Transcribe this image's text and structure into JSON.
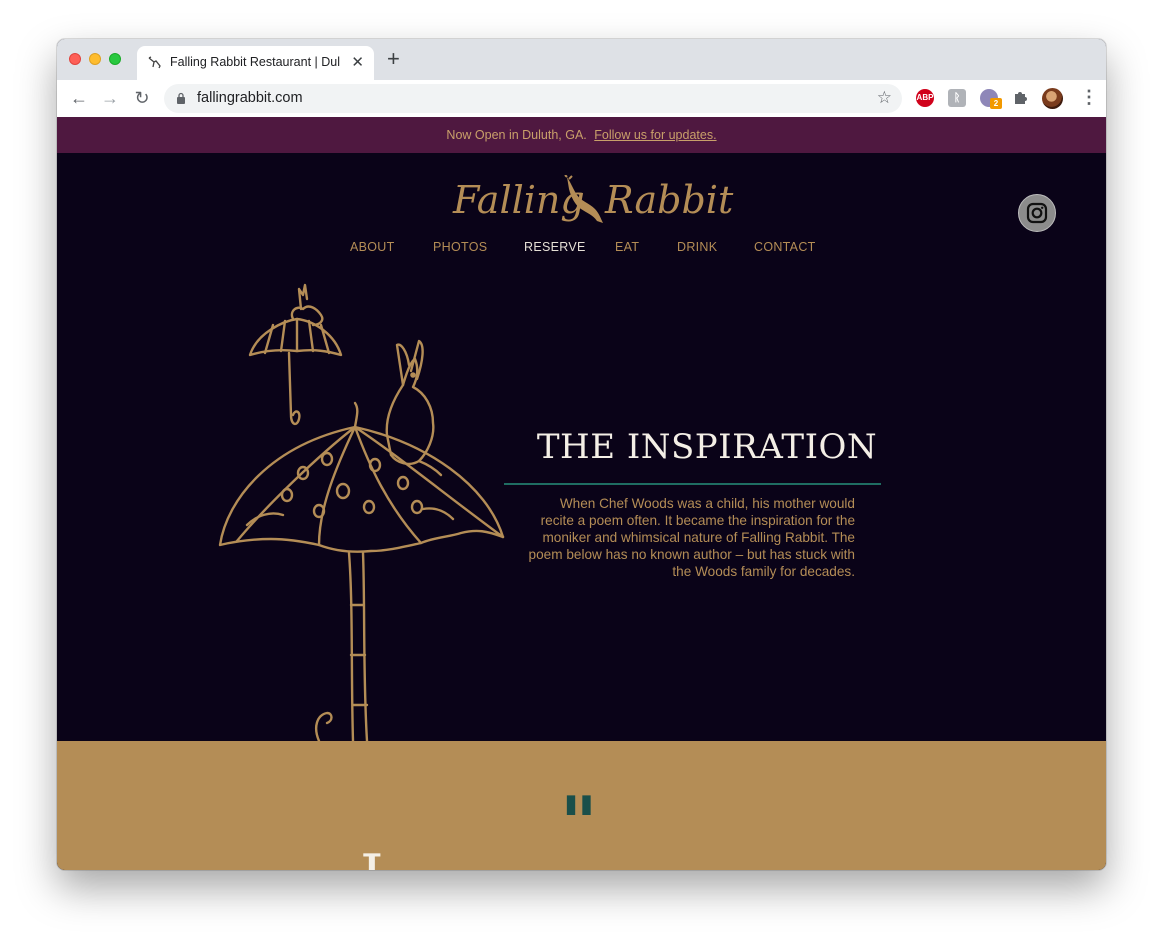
{
  "browser": {
    "tab_title": "Falling Rabbit Restaurant | Dulu",
    "url": "fallingrabbit.com",
    "extensions": [
      {
        "name": "adblock-plus",
        "label": "ABP",
        "color": "#d0021b"
      },
      {
        "name": "extension-generic",
        "label": "ᚱ",
        "color": "#9aa0a6"
      },
      {
        "name": "extension-badge",
        "label": "",
        "badge": "2",
        "color": "#8e87b8"
      }
    ]
  },
  "announcement": {
    "text": "Now Open in Duluth, GA.",
    "link": "Follow us for updates."
  },
  "logo": {
    "word1": "Falling",
    "word2": "Rabbit"
  },
  "nav": [
    {
      "label": "ABOUT"
    },
    {
      "label": "PHOTOS"
    },
    {
      "label": "RESERVE",
      "active": true
    },
    {
      "label": "EAT"
    },
    {
      "label": "DRINK"
    },
    {
      "label": "CONTACT"
    }
  ],
  "hero": {
    "title": "THE INSPIRATION",
    "text": "When Chef Woods was a child, his mother would recite a poem often. It became the inspiration for the moniker and whimsical nature of Falling Rabbit. The poem below has no known author – but has stuck with the Woods family for decades."
  },
  "quote_section": {
    "mark": "\"",
    "partial_letter": "I"
  },
  "colors": {
    "gold": "#b48d56",
    "deep_plum": "#0a0318",
    "announce_bar": "#4f1840",
    "teal": "#1f6d62"
  }
}
